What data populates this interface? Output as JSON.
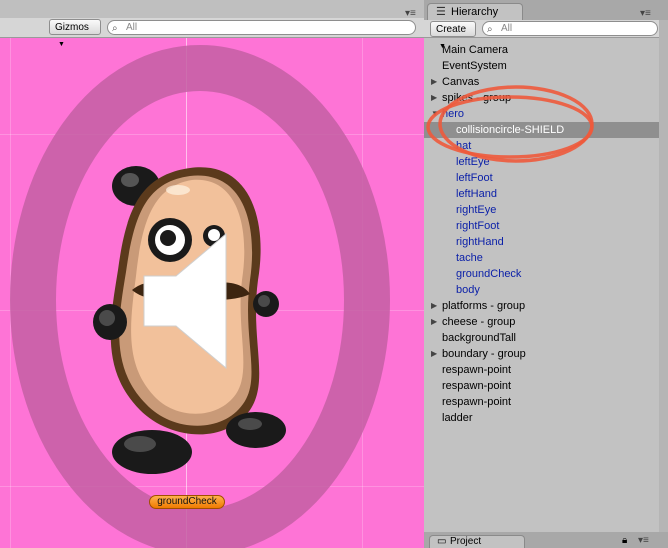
{
  "scene": {
    "gizmos_label": "Gizmos",
    "search_placeholder": "All",
    "ground_label": "groundCheck"
  },
  "hierarchy": {
    "tab_label": "Hierarchy",
    "create_label": "Create",
    "search_placeholder": "All",
    "items": [
      {
        "label": "Main Camera",
        "indent": 0,
        "arrow": "",
        "blue": false,
        "selected": false
      },
      {
        "label": "EventSystem",
        "indent": 0,
        "arrow": "",
        "blue": false,
        "selected": false
      },
      {
        "label": "Canvas",
        "indent": 0,
        "arrow": "▶",
        "blue": false,
        "selected": false
      },
      {
        "label": "spikes - group",
        "indent": 0,
        "arrow": "▶",
        "blue": false,
        "selected": false
      },
      {
        "label": "hero",
        "indent": 0,
        "arrow": "▼",
        "blue": true,
        "selected": false
      },
      {
        "label": "collisioncircle-SHIELD",
        "indent": 1,
        "arrow": "",
        "blue": true,
        "selected": true
      },
      {
        "label": "hat",
        "indent": 1,
        "arrow": "",
        "blue": true,
        "selected": false
      },
      {
        "label": "leftEye",
        "indent": 1,
        "arrow": "",
        "blue": true,
        "selected": false
      },
      {
        "label": "leftFoot",
        "indent": 1,
        "arrow": "",
        "blue": true,
        "selected": false
      },
      {
        "label": "leftHand",
        "indent": 1,
        "arrow": "",
        "blue": true,
        "selected": false
      },
      {
        "label": "rightEye",
        "indent": 1,
        "arrow": "",
        "blue": true,
        "selected": false
      },
      {
        "label": "rightFoot",
        "indent": 1,
        "arrow": "",
        "blue": true,
        "selected": false
      },
      {
        "label": "rightHand",
        "indent": 1,
        "arrow": "",
        "blue": true,
        "selected": false
      },
      {
        "label": "tache",
        "indent": 1,
        "arrow": "",
        "blue": true,
        "selected": false
      },
      {
        "label": "groundCheck",
        "indent": 1,
        "arrow": "",
        "blue": true,
        "selected": false
      },
      {
        "label": "body",
        "indent": 1,
        "arrow": "",
        "blue": true,
        "selected": false
      },
      {
        "label": "platforms - group",
        "indent": 0,
        "arrow": "▶",
        "blue": false,
        "selected": false
      },
      {
        "label": "cheese - group",
        "indent": 0,
        "arrow": "▶",
        "blue": false,
        "selected": false
      },
      {
        "label": "backgroundTall",
        "indent": 0,
        "arrow": "",
        "blue": false,
        "selected": false
      },
      {
        "label": "boundary - group",
        "indent": 0,
        "arrow": "▶",
        "blue": false,
        "selected": false
      },
      {
        "label": "respawn-point",
        "indent": 0,
        "arrow": "",
        "blue": false,
        "selected": false
      },
      {
        "label": "respawn-point",
        "indent": 0,
        "arrow": "",
        "blue": false,
        "selected": false
      },
      {
        "label": "respawn-point",
        "indent": 0,
        "arrow": "",
        "blue": false,
        "selected": false
      },
      {
        "label": "ladder",
        "indent": 0,
        "arrow": "",
        "blue": false,
        "selected": false
      }
    ]
  },
  "project": {
    "tab_label": "Project"
  },
  "colors": {
    "scene_bg": "#fe74d6",
    "highlight_ellipse": "#ee5a3c",
    "prefab_blue": "#0a1fa8",
    "selection": "#8f8f8f"
  }
}
